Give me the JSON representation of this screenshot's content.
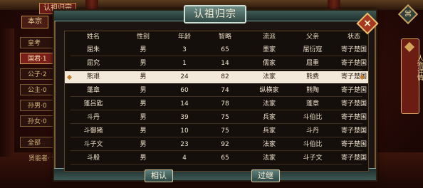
{
  "bg_menu": {
    "top_tab": "认祖归宗",
    "sub_tab": "本宗",
    "items": [
      {
        "label": "皇考",
        "selected": false
      },
      {
        "label": "国君·1",
        "selected": true
      },
      {
        "label": "公子·2",
        "selected": false
      },
      {
        "label": "公主·0",
        "selected": false
      },
      {
        "label": "孙男·0",
        "selected": false
      },
      {
        "label": "孙女·0",
        "selected": false
      },
      {
        "label": "全部",
        "selected": false
      }
    ],
    "bottom_note": "贤能者·\n训练"
  },
  "right_panel": {
    "top_icon": "⌘",
    "banner_label": "人物详情"
  },
  "modal": {
    "title": "认祖归宗",
    "columns": [
      "姓名",
      "性别",
      "年龄",
      "智略",
      "流派",
      "父亲",
      "状态"
    ],
    "rows": [
      {
        "name": "屈朱",
        "gender": "男",
        "age": "3",
        "intel": "65",
        "school": "墨家",
        "father": "屈衍寇",
        "status": "寄子楚国",
        "selected": false
      },
      {
        "name": "屈究",
        "gender": "男",
        "age": "1",
        "intel": "14",
        "school": "儒家",
        "father": "屈重",
        "status": "寄子楚国",
        "selected": false
      },
      {
        "name": "熊艰",
        "gender": "男",
        "age": "24",
        "intel": "82",
        "school": "法家",
        "father": "熊费",
        "status": "寄子楚国",
        "selected": true
      },
      {
        "name": "蓬章",
        "gender": "男",
        "age": "60",
        "intel": "74",
        "school": "纵横家",
        "father": "熊陶",
        "status": "寄子楚国",
        "selected": false
      },
      {
        "name": "蓬吕匙",
        "gender": "男",
        "age": "14",
        "intel": "78",
        "school": "法家",
        "father": "蓬章",
        "status": "寄子楚国",
        "selected": false
      },
      {
        "name": "斗丹",
        "gender": "男",
        "age": "39",
        "intel": "75",
        "school": "兵家",
        "father": "斗伯比",
        "status": "寄子楚国",
        "selected": false
      },
      {
        "name": "斗御猪",
        "gender": "男",
        "age": "10",
        "intel": "75",
        "school": "兵家",
        "father": "斗丹",
        "status": "寄子楚国",
        "selected": false
      },
      {
        "name": "斗子文",
        "gender": "男",
        "age": "23",
        "intel": "92",
        "school": "法家",
        "father": "斗伯比",
        "status": "寄子楚国",
        "selected": false
      },
      {
        "name": "斗般",
        "gender": "男",
        "age": "4",
        "intel": "65",
        "school": "法家",
        "father": "斗子文",
        "status": "寄子楚国",
        "selected": false
      }
    ],
    "confirm_label": "相认",
    "skip_label": "过继"
  },
  "colors": {
    "modal_bg": "#1b1410",
    "frame_teal": "#3e5a55",
    "gold_border": "#c9a15f",
    "selected_row": "#f3e9da",
    "close_red": "#a63a20"
  }
}
